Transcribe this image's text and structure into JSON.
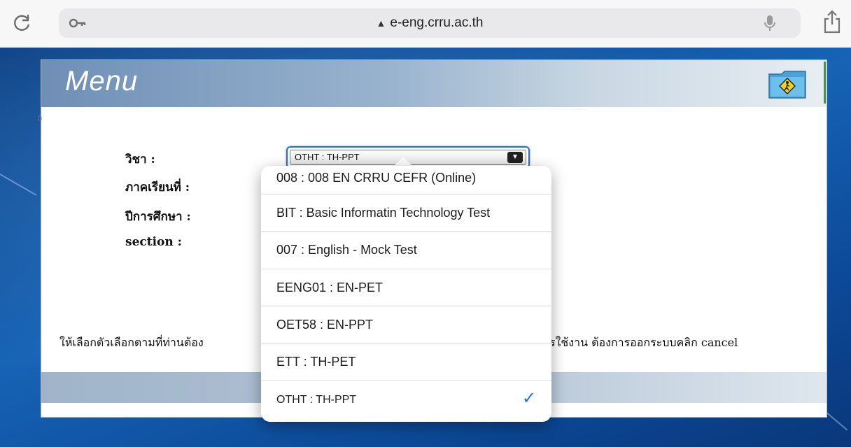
{
  "browser": {
    "url": "e-eng.crru.ac.th"
  },
  "window": {
    "title": "Menu"
  },
  "form": {
    "subject_label": "วิชา :",
    "semester_label": "ภาคเรียนที่ :",
    "year_label": "ปีการศึกษา :",
    "section_label": "section :",
    "selected_subject": "OTHT : TH-PPT"
  },
  "instruction": {
    "left": "ให้เลือกตัวเลือกตามที่ท่านต้อง",
    "right": "รใช้งาน ต้องการออกระบบคลิก cancel"
  },
  "dropdown": {
    "options": [
      {
        "label": "008 : 008 EN CRRU CEFR (Online)"
      },
      {
        "label": "BIT : Basic Informatin Technology Test"
      },
      {
        "label": "007 : English - Mock Test"
      },
      {
        "label": "EENG01 : EN-PET"
      },
      {
        "label": "OET58 : EN-PPT"
      },
      {
        "label": "ETT : TH-PET"
      },
      {
        "label": "OTHT : TH-PPT",
        "selected": true
      }
    ]
  },
  "colors": {
    "check": "#1a73e8",
    "desktop": "#0d3f86",
    "select_border": "#2c70c9"
  },
  "icons": [
    "reload-icon",
    "key-icon",
    "warning-icon",
    "mic-icon",
    "share-icon",
    "folder-icon",
    "home-icon",
    "check-icon",
    "chevron-down-icon"
  ]
}
